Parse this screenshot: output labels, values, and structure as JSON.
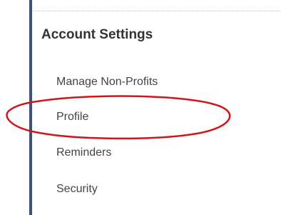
{
  "panel": {
    "title": "Account Settings"
  },
  "menu": {
    "items": [
      {
        "label": "Manage Non-Profits"
      },
      {
        "label": "Profile"
      },
      {
        "label": "Reminders"
      },
      {
        "label": "Security"
      }
    ]
  },
  "colors": {
    "border": "#3d5276",
    "highlight_ellipse": "#d0161d",
    "text": "#444444"
  },
  "annotation": {
    "shape": "ellipse",
    "highlights": "Profile"
  }
}
